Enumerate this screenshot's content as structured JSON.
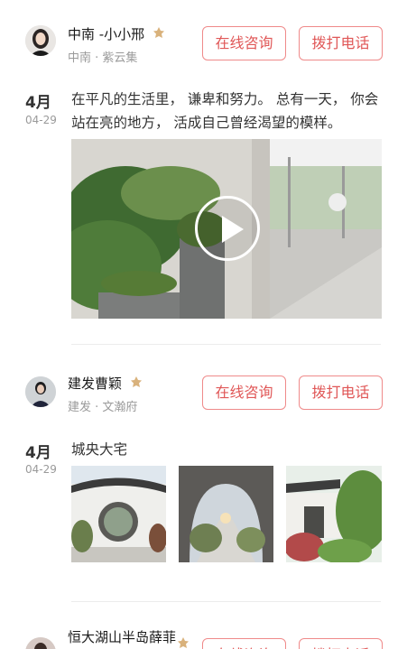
{
  "posts": [
    {
      "name": "中南 -小小邢",
      "sub": "中南 · 紫云集",
      "month": "4月",
      "day": "04-29",
      "text": "在平凡的生活里， 谦卑和努力。 总有一天， 你会站在亮的地方， 活成自己曾经渴望的模样。",
      "consult_label": "在线咨询",
      "call_label": "拨打电话"
    },
    {
      "name": "建发曹颖",
      "sub": "建发 · 文瀚府",
      "month": "4月",
      "day": "04-29",
      "text": "城央大宅",
      "consult_label": "在线咨询",
      "call_label": "拨打电话"
    },
    {
      "name": "恒大湖山半岛薛菲",
      "consult_label": "在线咨询",
      "call_label": "拨打电话"
    }
  ],
  "colors": {
    "accent": "#e05757",
    "border": "#ef8a8a",
    "muted": "#9a9a9a"
  }
}
